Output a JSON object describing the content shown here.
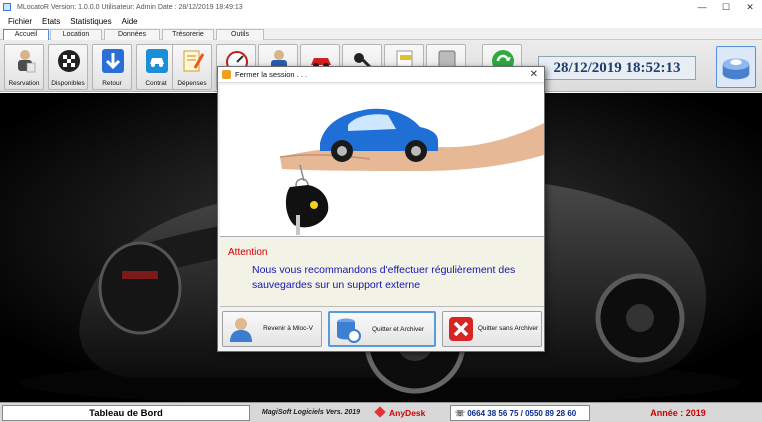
{
  "window": {
    "title": "MLocatoR  Version: 1.0.0.0   Utilisateur: Admin    Date : 28/12/2019 18:49:13",
    "controls": {
      "minimize": "—",
      "maximize": "☐",
      "close": "✕"
    }
  },
  "menu": [
    "Fichier",
    "Etats",
    "Statistiques",
    "Aide"
  ],
  "tabs": [
    "Accueil",
    "Location",
    "Données",
    "Trésorerie",
    "Outils"
  ],
  "toolbar": {
    "buttons": [
      {
        "label": "Resrvation",
        "icon": "reservation-icon"
      },
      {
        "label": "Disponibles",
        "icon": "checkered-flag-icon"
      },
      {
        "label": "Retour",
        "icon": "down-arrow-icon"
      },
      {
        "label": "Contrat",
        "icon": "car-contract-icon"
      },
      {
        "label": "Dépenses",
        "icon": "expense-pen-icon"
      },
      {
        "label": "",
        "icon": "gauge-icon"
      },
      {
        "label": "",
        "icon": "mechanic-icon"
      },
      {
        "label": "",
        "icon": "red-car-icon"
      },
      {
        "label": "",
        "icon": "key-icon"
      },
      {
        "label": "",
        "icon": "document-icon"
      },
      {
        "label": "",
        "icon": "calculator-icon"
      },
      {
        "label": "",
        "icon": "refresh-icon"
      }
    ]
  },
  "clock": "28/12/2019 18:52:13",
  "dialog": {
    "title": "Fermer la session . . .",
    "attention": "Attention",
    "message": "Nous vous recommandons d'effectuer régulièrement des sauvegardes sur un support externe",
    "buttons": {
      "back": "Revenir à Mloc-V",
      "quit_archive": "Quitter et Archiver",
      "quit_no_archive": "Quitter sans Archiver"
    }
  },
  "statusbar": {
    "dashboard": "Tableau de Bord",
    "version": "MagiSoft Logiciels Vers. 2019",
    "anydesk": "AnyDesk",
    "phone": "0664 38 56 75 / 0550 89 28 60",
    "year": "Année : 2019"
  },
  "colors": {
    "accent_blue": "#1515b0",
    "attention_red": "#d00000",
    "clock_text": "#1e3e6b",
    "year_red": "#cc0000"
  }
}
